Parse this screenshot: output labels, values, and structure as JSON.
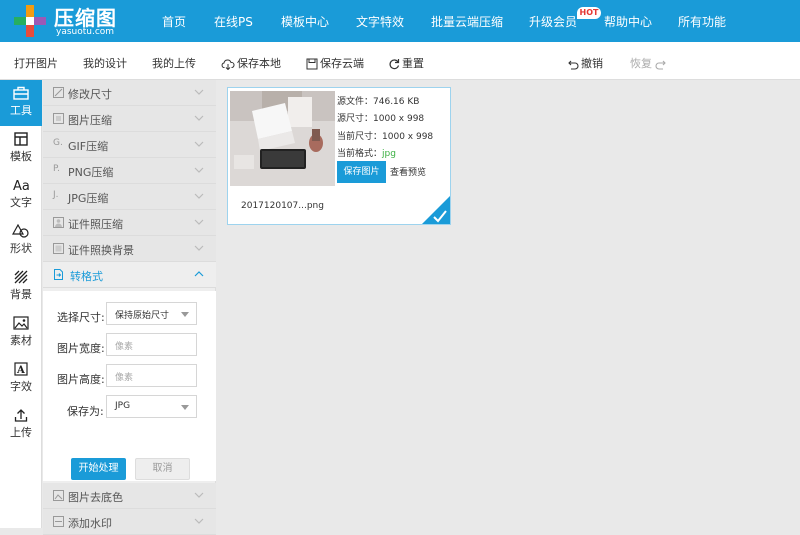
{
  "brand": {
    "title": "压缩图",
    "subtitle": "yasuotu.com"
  },
  "nav": {
    "items": [
      "首页",
      "在线PS",
      "模板中心",
      "文字特效",
      "批量云端压缩",
      "升级会员",
      "帮助中心",
      "所有功能"
    ],
    "hot_badge": "HOT"
  },
  "toolbar": {
    "open": "打开图片",
    "my_designs": "我的设计",
    "my_uploads": "我的上传",
    "save_local": "保存本地",
    "save_cloud": "保存云端",
    "reset": "重置",
    "undo": "撤销",
    "redo": "恢复"
  },
  "leftbar": {
    "items": [
      {
        "label": "工具",
        "icon": "toolbox-icon",
        "active": true
      },
      {
        "label": "模板",
        "icon": "template-icon",
        "active": false
      },
      {
        "label": "文字",
        "icon": "text-icon",
        "active": false
      },
      {
        "label": "形状",
        "icon": "shape-icon",
        "active": false
      },
      {
        "label": "背景",
        "icon": "background-icon",
        "active": false
      },
      {
        "label": "素材",
        "icon": "material-icon",
        "active": false
      },
      {
        "label": "字效",
        "icon": "text-effect-icon",
        "active": false
      },
      {
        "label": "上传",
        "icon": "upload-icon",
        "active": false
      }
    ]
  },
  "panel": {
    "sections": [
      {
        "label": "修改尺寸",
        "icon": "resize-icon"
      },
      {
        "label": "图片压缩",
        "icon": "compress-icon"
      },
      {
        "label": "GIF压缩",
        "icon": "gif-icon",
        "prefix": "G."
      },
      {
        "label": "PNG压缩",
        "icon": "png-icon",
        "prefix": "P."
      },
      {
        "label": "JPG压缩",
        "icon": "jpg-icon",
        "prefix": "J."
      },
      {
        "label": "证件照压缩",
        "icon": "id-photo-icon"
      },
      {
        "label": "证件照换背景",
        "icon": "id-bg-icon"
      },
      {
        "label": "转格式",
        "icon": "convert-icon",
        "open": true
      },
      {
        "label": "图片去底色",
        "icon": "remove-bg-icon"
      },
      {
        "label": "添加水印",
        "icon": "watermark-icon"
      }
    ],
    "convert_form": {
      "size_label": "选择尺寸:",
      "size_value": "保持原始尺寸",
      "width_label": "图片宽度:",
      "width_placeholder": "像素",
      "height_label": "图片高度:",
      "height_placeholder": "像素",
      "saveas_label": "保存为:",
      "saveas_value": "JPG",
      "start_button": "开始处理",
      "cancel_button": "取消"
    }
  },
  "card": {
    "source_file_label": "源文件：",
    "source_file_value": "746.16 KB",
    "source_size_label": "源尺寸：",
    "source_size_value": "1000 x 998",
    "current_size_label": "当前尺寸：",
    "current_size_value": "1000 x 998",
    "current_format_label": "当前格式：",
    "current_format_value": "jpg",
    "save_button": "保存图片",
    "preview_link": "查看预览",
    "filename": "2017120107...png"
  },
  "colors": {
    "accent": "#1a9bd8",
    "format_green": "#3cb043",
    "hot_red": "#e53935"
  }
}
